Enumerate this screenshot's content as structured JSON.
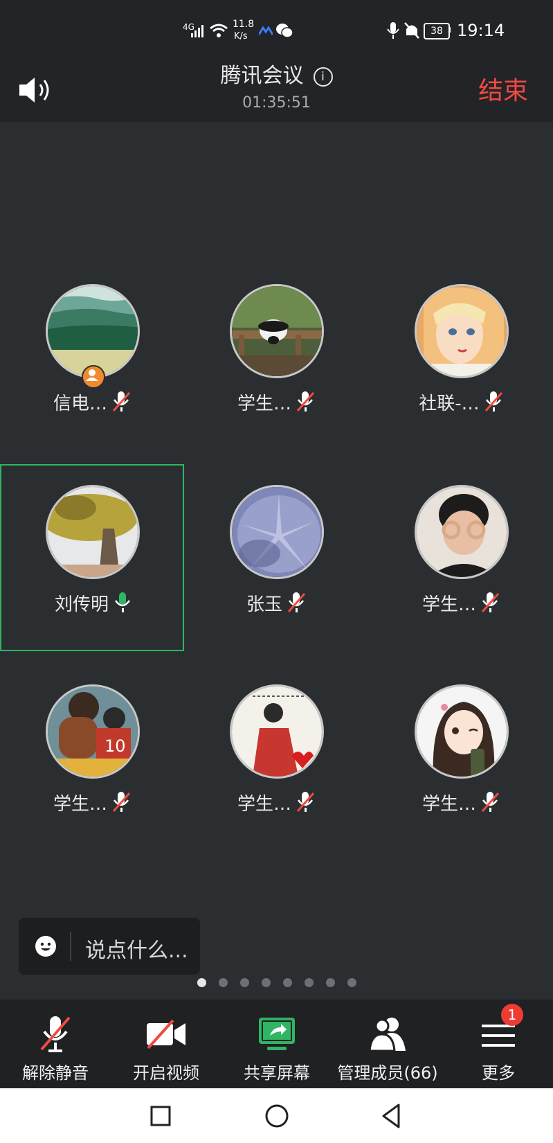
{
  "status_bar": {
    "network": "4G",
    "speed_value": "11.8",
    "speed_unit": "K/s",
    "battery": "38",
    "time": "19:14"
  },
  "header": {
    "title": "腾讯会议",
    "timer": "01:35:51",
    "end_label": "结束"
  },
  "participants": [
    {
      "name": "信电…",
      "muted": true,
      "host": true
    },
    {
      "name": "学生…",
      "muted": true
    },
    {
      "name": "社联-…",
      "muted": true
    },
    {
      "name": "刘传明",
      "muted": false,
      "speaking": true
    },
    {
      "name": "张玉",
      "muted": true
    },
    {
      "name": "学生…",
      "muted": true
    },
    {
      "name": "学生…",
      "muted": true
    },
    {
      "name": "学生…",
      "muted": true
    },
    {
      "name": "学生…",
      "muted": true
    }
  ],
  "chat": {
    "placeholder": "说点什么..."
  },
  "pagination": {
    "pages": 8,
    "current": 1
  },
  "toolbar": {
    "unmute": "解除静音",
    "video": "开启视频",
    "share": "共享屏幕",
    "members": "管理成员(66)",
    "more": "更多",
    "more_badge": "1"
  },
  "colors": {
    "end_red": "#f04a42",
    "active_green": "#2fb563",
    "share_green": "#2fb563"
  }
}
